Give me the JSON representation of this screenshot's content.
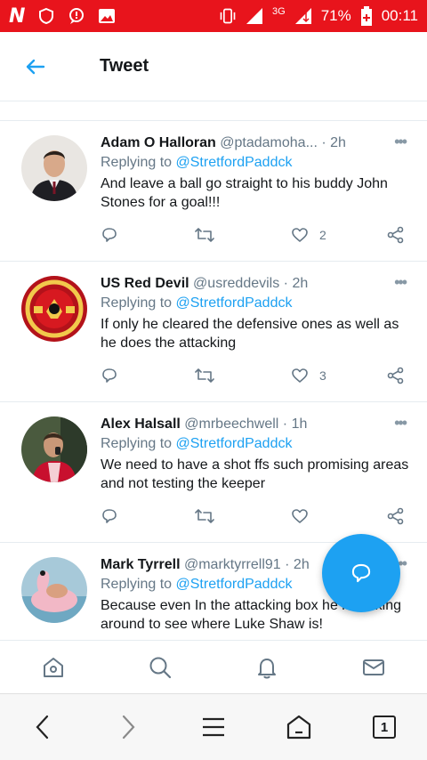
{
  "status_bar": {
    "network": "3G",
    "battery": "71%",
    "time": "00:11"
  },
  "header": {
    "title": "Tweet"
  },
  "tweets": [
    {
      "name": "Adam O Halloran",
      "handle": "@ptadamoha...",
      "time": "2h",
      "replying_prefix": "Replying to",
      "replying_to": "@StretfordPaddck",
      "text": "And leave a ball go straight to his buddy John Stones for a goal!!!",
      "likes": "2"
    },
    {
      "name": "US Red Devil",
      "handle": "@usreddevils",
      "time": "2h",
      "replying_prefix": "Replying to",
      "replying_to": "@StretfordPaddck",
      "text": "If only he cleared the defensive ones as well as he does the attacking",
      "likes": "3"
    },
    {
      "name": "Alex Halsall",
      "handle": "@mrbeechwell",
      "time": "1h",
      "replying_prefix": "Replying to",
      "replying_to": "@StretfordPaddck",
      "text": "We need to have a shot ffs such promising areas and not testing the keeper",
      "likes": ""
    },
    {
      "name": "Mark Tyrrell",
      "handle": "@marktyrrell91",
      "time": "2h",
      "replying_prefix": "Replying to",
      "replying_to": "@StretfordPaddck",
      "text": "Because even In the attacking box he is looking around to see where Luke Shaw is!",
      "likes": ""
    }
  ],
  "colors": {
    "status_bar": "#e8141c",
    "accent": "#1da1f2",
    "muted": "#657786"
  },
  "browser": {
    "tab_count": "1"
  }
}
